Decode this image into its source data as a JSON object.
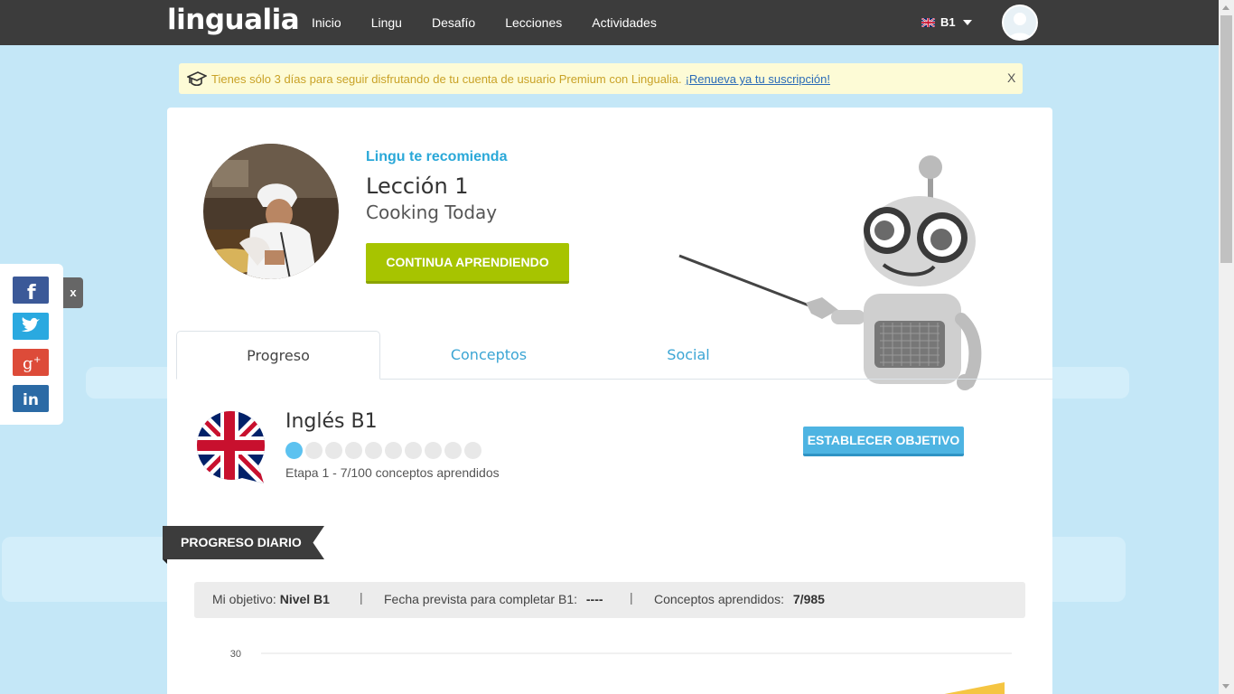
{
  "header": {
    "logo": "lingualia",
    "nav": [
      "Inicio",
      "Lingu",
      "Desafío",
      "Lecciones",
      "Actividades"
    ],
    "level": "B1"
  },
  "notice": {
    "text": "Tienes sólo 3 días para seguir disfrutando de tu cuenta de usuario Premium con Lingualia.",
    "link": "¡Renueva ya tu suscripción!",
    "close": "X"
  },
  "social": {
    "close": "x"
  },
  "recommendation": {
    "label": "Lingu te recomienda",
    "lesson_title": "Lección 1",
    "lesson_subtitle": "Cooking Today",
    "button": "CONTINUA APRENDIENDO"
  },
  "tabs": [
    "Progreso",
    "Conceptos",
    "Social"
  ],
  "course": {
    "title": "Inglés B1",
    "stage": "Etapa 1 - 7/100 conceptos aprendidos",
    "progress_dots_total": 10,
    "progress_dots_filled": 1,
    "goal_button": "ESTABLECER OBJETIVO"
  },
  "daily": {
    "ribbon": "PROGRESO DIARIO",
    "goal_label": "Mi objetivo:",
    "goal_value": "Nivel B1",
    "date_label": "Fecha prevista para completar B1:",
    "date_value": "----",
    "concepts_label": "Conceptos aprendidos:",
    "concepts_value": "7/985"
  },
  "chart_data": {
    "type": "area",
    "y_tick_labels": [
      "30"
    ],
    "ylim": [
      0,
      30
    ],
    "grid": true
  },
  "colors": {
    "accent_green": "#a7c400",
    "accent_blue": "#4eb4e2",
    "link_blue": "#3ba5d4",
    "header_bg": "#3c3c3c",
    "page_bg": "#c4e7f7"
  }
}
